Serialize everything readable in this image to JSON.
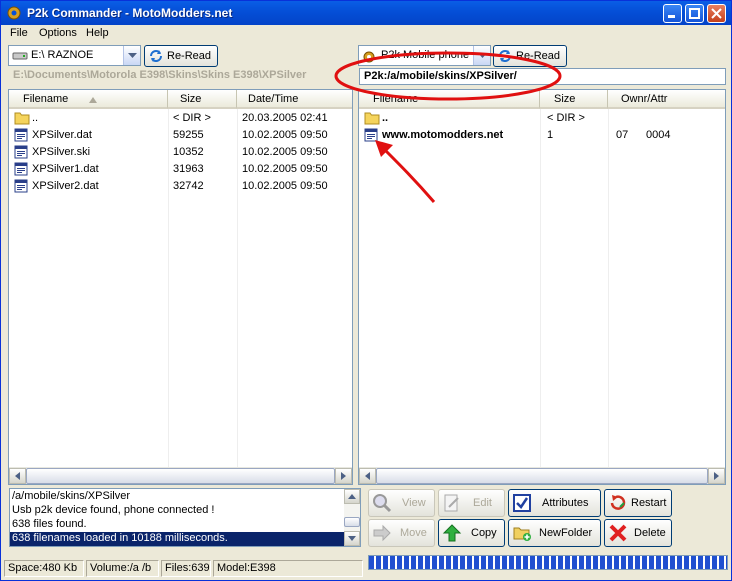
{
  "window": {
    "title": "P2k Commander - MotoModders.net"
  },
  "menu": {
    "items": [
      "File",
      "Options",
      "Help"
    ]
  },
  "left": {
    "drive": "E:\\ RAZNOE",
    "reread_label": "Re-Read",
    "path": "E:\\Documents\\Motorola E398\\Skins\\Skins E398\\XPSilver",
    "columns": [
      "Filename",
      "Size",
      "Date/Time"
    ],
    "rows": [
      {
        "name": "..",
        "size": "< DIR >",
        "date": "20.03.2005 02:41",
        "icon": "folder-icon"
      },
      {
        "name": "XPSilver.dat",
        "size": "59255",
        "date": "10.02.2005 09:50",
        "icon": "file-icon"
      },
      {
        "name": "XPSilver.ski",
        "size": "10352",
        "date": "10.02.2005 09:50",
        "icon": "file-icon"
      },
      {
        "name": "XPSilver1.dat",
        "size": "31963",
        "date": "10.02.2005 09:50",
        "icon": "file-icon"
      },
      {
        "name": "XPSilver2.dat",
        "size": "32742",
        "date": "10.02.2005 09:50",
        "icon": "file-icon"
      }
    ]
  },
  "right": {
    "drive": "P2k Mobile phone",
    "reread_label": "Re-Read",
    "path": "P2k:/a/mobile/skins/XPSilver/",
    "columns": [
      "Filename",
      "Size",
      "Ownr/Attr"
    ],
    "rows": [
      {
        "name": "..",
        "size": "< DIR >",
        "owner": "",
        "attr": "",
        "icon": "folder-icon"
      },
      {
        "name": "www.motomodders.net",
        "size": "1",
        "owner": "07",
        "attr": "0004",
        "icon": "file-icon"
      }
    ]
  },
  "log": {
    "lines": [
      "/a/mobile/skins/XPSilver",
      "Usb p2k device found, phone connected !",
      "638 files found.",
      "638 filenames loaded in 10188 milliseconds."
    ]
  },
  "buttons": {
    "view": "View",
    "edit": "Edit",
    "attributes": "Attributes",
    "restart": "Restart",
    "move": "Move",
    "copy": "Copy",
    "newfolder": "NewFolder",
    "delete": "Delete"
  },
  "status": {
    "space": "Space:480 Kb",
    "volume": "Volume:/a /b",
    "files": "Files:639",
    "model": "Model:E398"
  },
  "colors": {
    "title_bar": "#0550d8",
    "selection": "#0a246a",
    "annotation": "#e01010"
  }
}
